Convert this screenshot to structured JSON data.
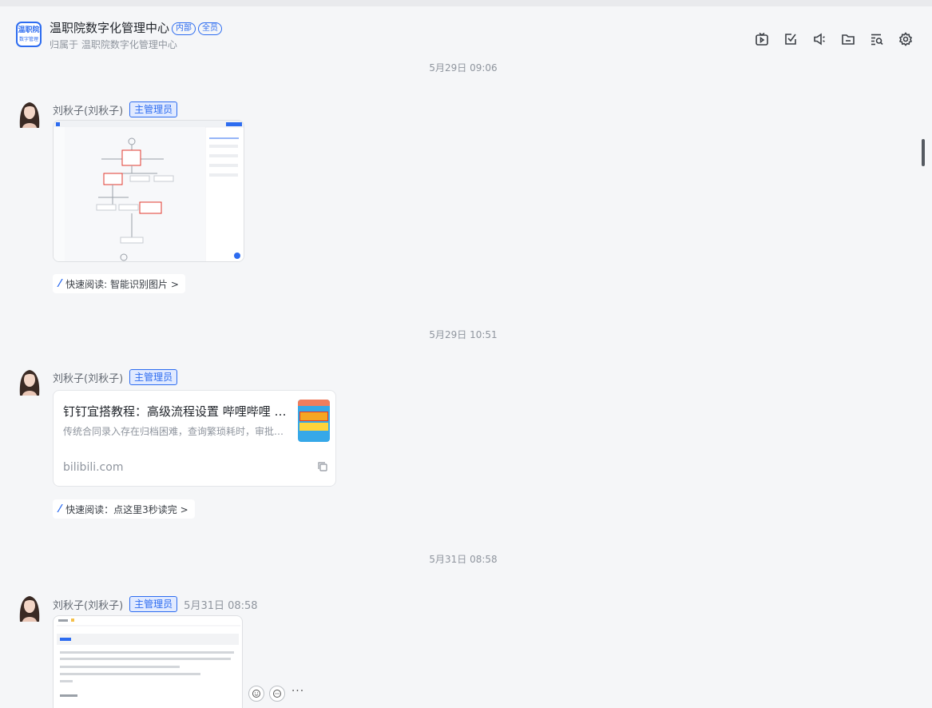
{
  "header": {
    "logo_line1": "温职院",
    "logo_line2": "数字管理",
    "title": "温职院数字化管理中心",
    "tag_internal": "内部",
    "tag_all": "全员",
    "subtitle": "归属于 温职院数字化管理中心",
    "icons": [
      "live-video-icon",
      "todo-check-icon",
      "announcement-icon",
      "folder-icon",
      "search-history-icon",
      "settings-gear-icon"
    ]
  },
  "messages": [
    {
      "time": "5月29日 09:06",
      "sender": "刘秋子(刘秋子)",
      "role": "主管理员",
      "type": "image",
      "quick_read": "快速阅读: 智能识别图片 >"
    },
    {
      "time": "5月29日 10:51",
      "sender": "刘秋子(刘秋子)",
      "role": "主管理员",
      "type": "link",
      "link_title": "钉钉宜搭教程：高级流程设置 哔哩哔哩 bilibili",
      "link_desc": "传统合同录入存在归档困难，查询繁琐耗时，审批效率低等问题",
      "link_domain": "bilibili.com",
      "quick_read": "快速阅读：点这里3秒读完 >"
    },
    {
      "time": "5月31日 08:58",
      "sender": "刘秋子(刘秋子)",
      "role": "主管理员",
      "stamp": "5月31日 08:58",
      "type": "image"
    }
  ],
  "hover_more": "···",
  "colors": {
    "accent": "#2d6cf0",
    "badge_bg": "#e1eaff",
    "page_bg": "#f5f6f8"
  }
}
